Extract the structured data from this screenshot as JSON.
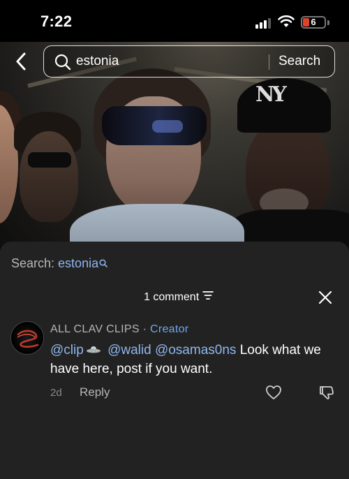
{
  "status_bar": {
    "time": "7:22",
    "battery": "6",
    "battery_level_percent": 6,
    "battery_color": "#e0412d"
  },
  "search": {
    "query": "estonia",
    "button_label": "Search",
    "back_icon": "chevron-left-icon",
    "search_icon": "magnifier-icon"
  },
  "comments_sheet": {
    "suggestion_prefix": "Search: ",
    "suggestion_term": "estonia",
    "count_label": "1 comment",
    "sort_icon": "filter-icon",
    "close_icon": "close-icon",
    "comments": [
      {
        "author": "ALL CLAV CLIPS",
        "separator": "·",
        "badge": "Creator",
        "mentions": [
          "@clip",
          "@walid",
          "@osamas0ns"
        ],
        "text": "Look what we have here, post if you want.",
        "age": "2d",
        "reply_label": "Reply"
      }
    ]
  },
  "colors": {
    "sheet_bg": "#222222",
    "mention_blue": "#8fb7ee",
    "creator_blue": "#6ea9ec",
    "muted_text": "#b5b5b5"
  }
}
